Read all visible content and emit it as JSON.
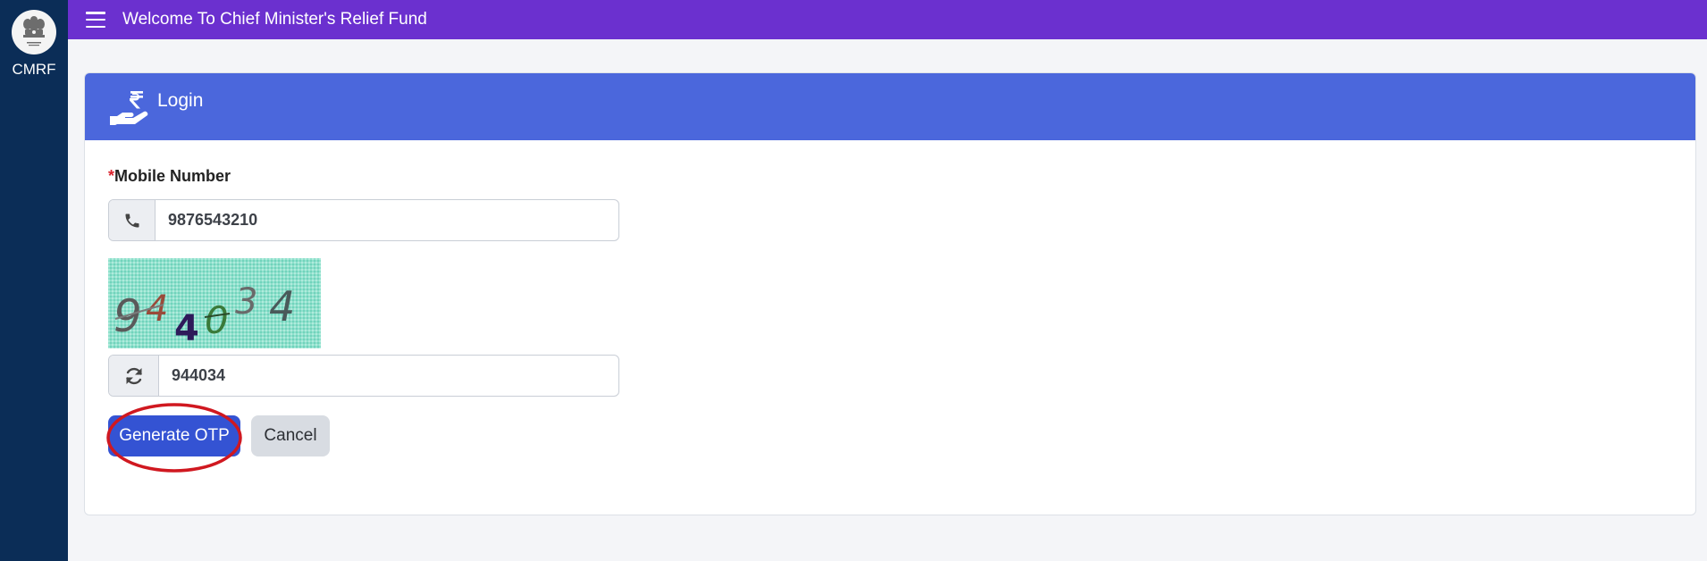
{
  "sidebar": {
    "brand": "CMRF",
    "emblem_icon": "national-emblem-icon"
  },
  "topbar": {
    "menu_icon": "hamburger-menu-icon",
    "title": "Welcome To Chief Minister's Relief Fund"
  },
  "card": {
    "header_icon": "hand-rupee-icon",
    "title": "Login"
  },
  "form": {
    "mobile": {
      "required_mark": "*",
      "label": "Mobile Number",
      "value": "9876543210",
      "icon": "phone-icon"
    },
    "captcha": {
      "image_text": "944034",
      "value": "944034",
      "refresh_icon": "refresh-icon"
    },
    "buttons": {
      "generate_otp": "Generate OTP",
      "cancel": "Cancel"
    }
  },
  "colors": {
    "sidebar": "#0b2d57",
    "topbar": "#6b30cf",
    "card_header": "#4b67dc",
    "primary_button": "#3453d3",
    "highlight": "#d01820"
  }
}
